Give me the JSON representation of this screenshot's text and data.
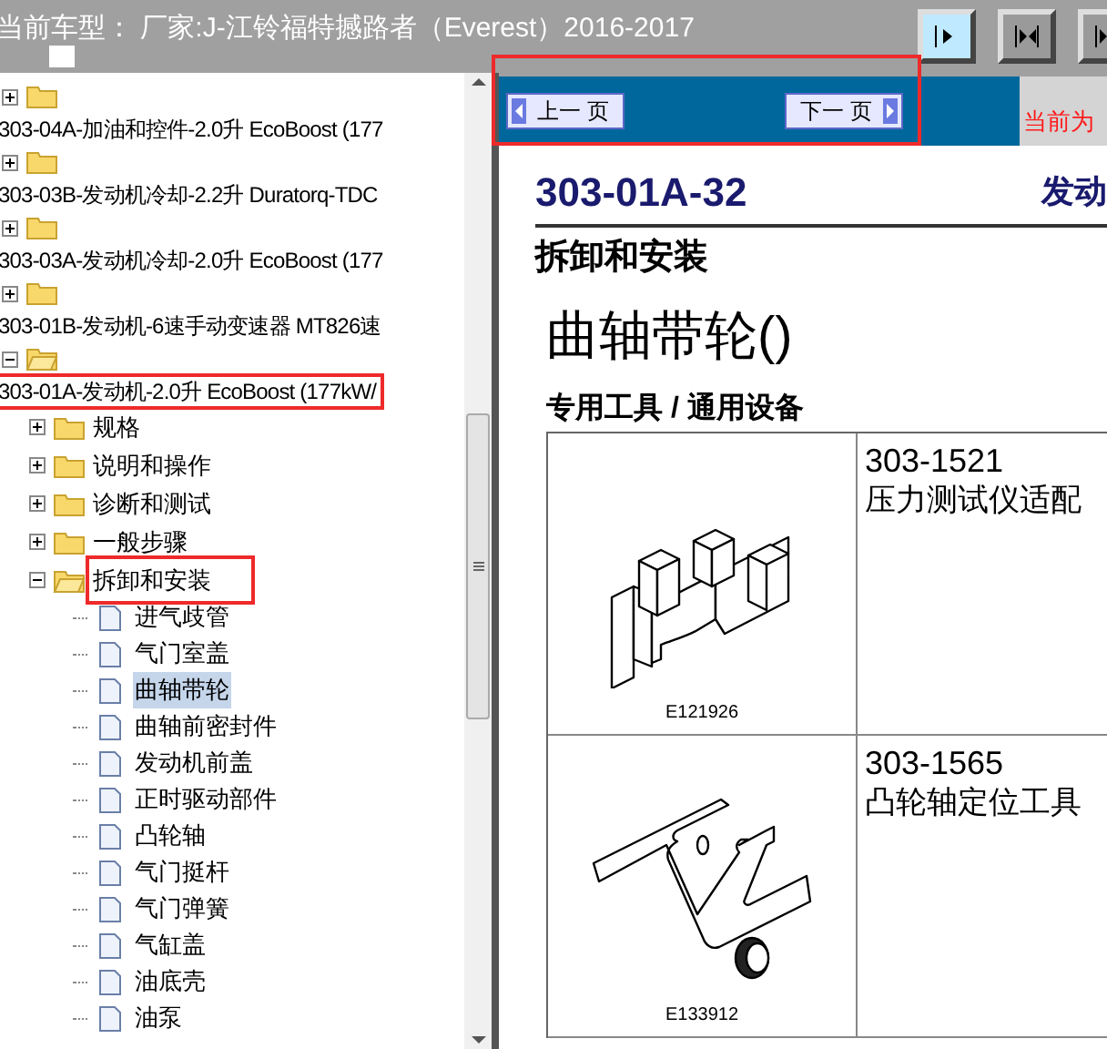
{
  "header": {
    "title": "当前车型：  厂家:J-江铃福特撼路者（Everest）2016-2017"
  },
  "nav": {
    "highlighted": true,
    "prev": "上一 页",
    "next": "下一 页",
    "current": "当前为"
  },
  "tree": [
    {
      "label": "303-04A-加油和控件-2.0升 EcoBoost (177",
      "expanded": false,
      "highlighted": false
    },
    {
      "label": "303-03B-发动机冷却-2.2升 Duratorq-TDC",
      "expanded": false,
      "highlighted": false
    },
    {
      "label": "303-03A-发动机冷却-2.0升 EcoBoost (177",
      "expanded": false,
      "highlighted": false
    },
    {
      "label": "303-01B-发动机-6速手动变速器 MT826速",
      "expanded": false,
      "highlighted": false
    },
    {
      "label": "303-01A-发动机-2.0升 EcoBoost (177kW/",
      "expanded": true,
      "highlighted": true,
      "children": [
        {
          "label": "规格",
          "expanded": false,
          "highlighted": false
        },
        {
          "label": "说明和操作",
          "expanded": false,
          "highlighted": false
        },
        {
          "label": "诊断和测试",
          "expanded": false,
          "highlighted": false
        },
        {
          "label": "一般步骤",
          "expanded": false,
          "highlighted": false
        },
        {
          "label": "拆卸和安装",
          "expanded": true,
          "highlighted": true,
          "children": [
            {
              "label": "进气歧管",
              "selected": false
            },
            {
              "label": "气门室盖",
              "selected": false
            },
            {
              "label": "曲轴带轮",
              "selected": true
            },
            {
              "label": "曲轴前密封件",
              "selected": false
            },
            {
              "label": "发动机前盖",
              "selected": false
            },
            {
              "label": "正时驱动部件",
              "selected": false
            },
            {
              "label": "凸轮轴",
              "selected": false
            },
            {
              "label": "气门挺杆",
              "selected": false
            },
            {
              "label": "气门弹簧",
              "selected": false
            },
            {
              "label": "气缸盖",
              "selected": false
            },
            {
              "label": "油底壳",
              "selected": false
            },
            {
              "label": "油泵",
              "selected": false
            }
          ]
        }
      ]
    }
  ],
  "document": {
    "code": "303-01A-32",
    "section": "发动",
    "subtitle": "拆卸和安装",
    "title": "曲轴带轮()",
    "tools_heading": "专用工具 / 通用设备",
    "tools": [
      {
        "kind": "clamp",
        "image_code": "E121926",
        "number": "303-1521",
        "name": "压力测试仪适配"
      },
      {
        "kind": "bracket",
        "image_code": "E133912",
        "number": "303-1565",
        "name": "凸轮轴定位工具"
      }
    ]
  }
}
